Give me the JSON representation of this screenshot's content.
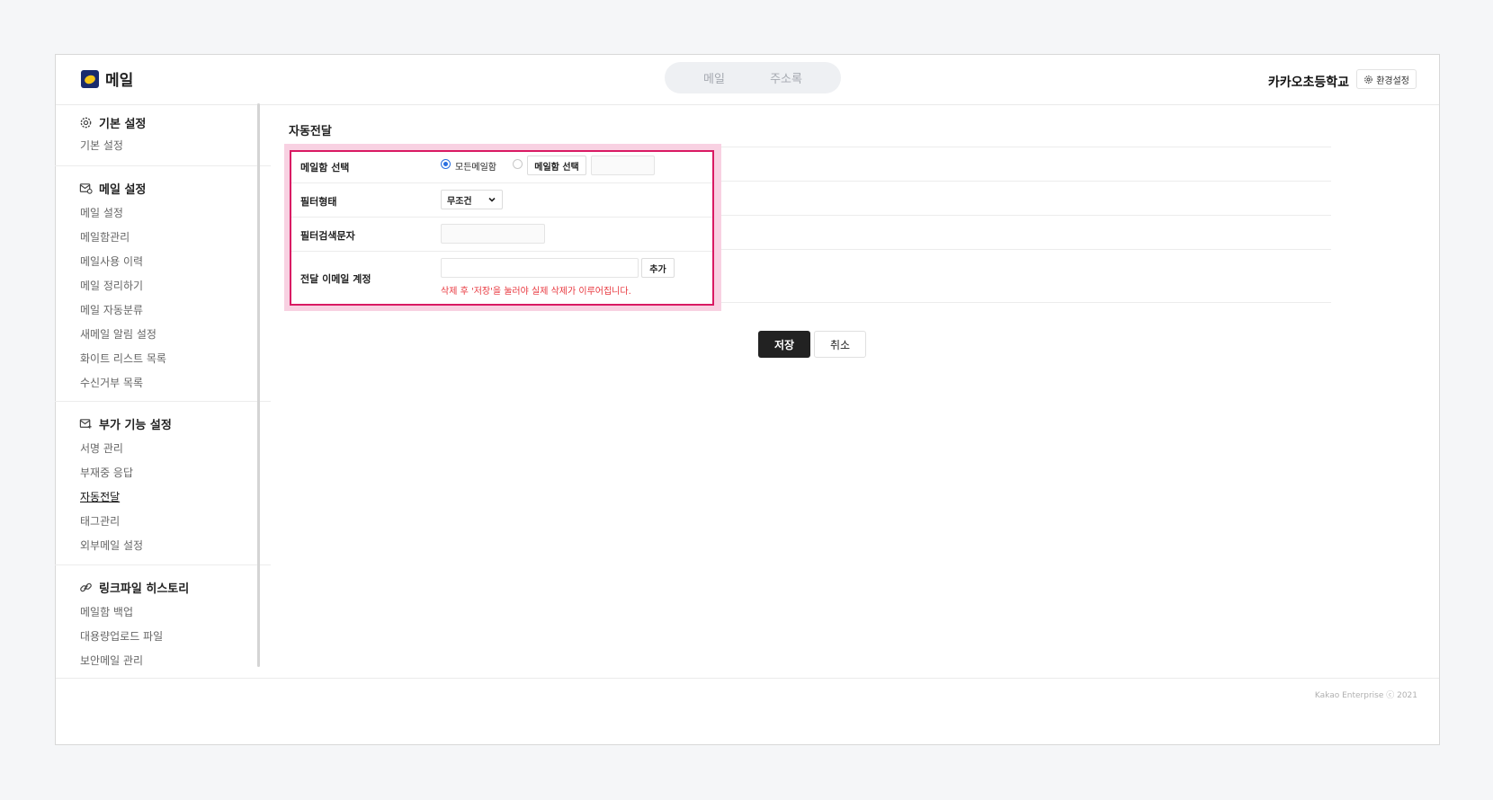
{
  "header": {
    "logo_text": "메일",
    "nav": [
      "메일",
      "주소록"
    ],
    "org_name": "카카오초등학교",
    "settings_label": "환경설정"
  },
  "sidebar": {
    "sections": [
      {
        "title": "기본 설정",
        "icon": "gear-icon",
        "items": [
          "기본 설정"
        ]
      },
      {
        "title": "메일 설정",
        "icon": "mail-settings-icon",
        "items": [
          "메일 설정",
          "메일함관리",
          "메일사용 이력",
          "메일 정리하기",
          "메일 자동분류",
          "새메일 알림 설정",
          "화이트 리스트 목록",
          "수신거부 목록"
        ]
      },
      {
        "title": "부가 기능 설정",
        "icon": "mail-plus-icon",
        "items": [
          "서명 관리",
          "부재중 응답",
          "자동전달",
          "태그관리",
          "외부메일 설정"
        ]
      },
      {
        "title": "링크파일 히스토리",
        "icon": "link-icon",
        "items": [
          "메일함 백업",
          "대용량업로드 파일",
          "보안메일 관리"
        ]
      }
    ],
    "active_item": "자동전달"
  },
  "main": {
    "title": "자동전달",
    "form": {
      "mailbox_label": "메일함 선택",
      "radio_all": "모든메일함",
      "mailbox_select_button": "메일함 선택",
      "filter_type_label": "필터형태",
      "filter_type_value": "무조건",
      "filter_text_label": "필터검색문자",
      "forward_label": "전달 이메일 계정",
      "add_button": "추가",
      "warning": "삭제 후 '저장'을 눌러야 실제 삭제가 이루어집니다."
    },
    "save_button": "저장",
    "cancel_button": "취소"
  },
  "footer": {
    "copyright": "Kakao Enterprise ⓒ 2021"
  },
  "colors": {
    "highlight_border": "#d91a63",
    "highlight_bg": "#f8d1e2",
    "radio_accent": "#2b6fe0",
    "warning": "#e8373e"
  }
}
